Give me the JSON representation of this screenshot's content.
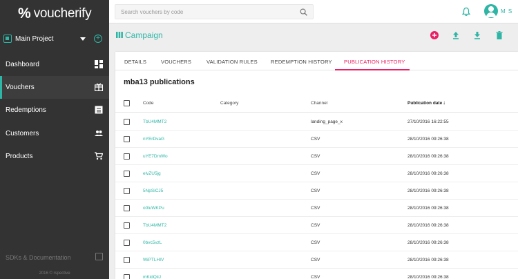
{
  "app": {
    "logo_mark": "%",
    "logo_text": "voucherify",
    "project": "Main Project",
    "sdk_label": "SDKs & Documentation",
    "copyright": "2016 © rspective"
  },
  "sidebar": {
    "items": [
      {
        "label": "Dashboard",
        "icon": "dashboard-icon"
      },
      {
        "label": "Vouchers",
        "icon": "gift-icon"
      },
      {
        "label": "Redemptions",
        "icon": "list-icon"
      },
      {
        "label": "Customers",
        "icon": "people-icon"
      },
      {
        "label": "Products",
        "icon": "cart-icon"
      }
    ],
    "active_index": 1
  },
  "topbar": {
    "search_placeholder": "Search vouchers by code",
    "user_initials": "M S"
  },
  "page": {
    "title": "Campaign"
  },
  "tabs": [
    "DETAILS",
    "VOUCHERS",
    "VALIDATION RULES",
    "REDEMPTION HISTORY",
    "PUBLICATION HISTORY"
  ],
  "active_tab": 4,
  "card": {
    "title": "mba13 publications"
  },
  "table": {
    "columns": [
      "Code",
      "Category",
      "Channel",
      "Publication date"
    ],
    "sort_indicator": "↓",
    "rows": [
      {
        "code": "TbU4MMT2",
        "category": "",
        "channel": "landing_page_x",
        "date": "27/10/2016 16:22:55"
      },
      {
        "code": "nYErDvaG",
        "category": "",
        "channel": "CSV",
        "date": "28/10/2016 09:26:38"
      },
      {
        "code": "uYE7DmWo",
        "category": "",
        "channel": "CSV",
        "date": "28/10/2016 09:26:38"
      },
      {
        "code": "elvZU5jg",
        "category": "",
        "channel": "CSV",
        "date": "28/10/2016 09:26:38"
      },
      {
        "code": "5NpSiCJ5",
        "category": "",
        "channel": "CSV",
        "date": "28/10/2016 09:26:38"
      },
      {
        "code": "o0luWKPu",
        "category": "",
        "channel": "CSV",
        "date": "28/10/2016 09:26:38"
      },
      {
        "code": "TbU4MMT2",
        "category": "",
        "channel": "CSV",
        "date": "28/10/2016 09:26:38"
      },
      {
        "code": "0bvc5vzL",
        "category": "",
        "channel": "CSV",
        "date": "28/10/2016 09:26:38"
      },
      {
        "code": "WiPTLHIV",
        "category": "",
        "channel": "CSV",
        "date": "28/10/2016 09:26:38"
      },
      {
        "code": "mKidQiiJ",
        "category": "",
        "channel": "CSV",
        "date": "28/10/2016 09:26:38"
      }
    ]
  },
  "colors": {
    "accent": "#2fb5a5",
    "active_tab": "#e91e63",
    "sidebar_bg": "#333333"
  }
}
